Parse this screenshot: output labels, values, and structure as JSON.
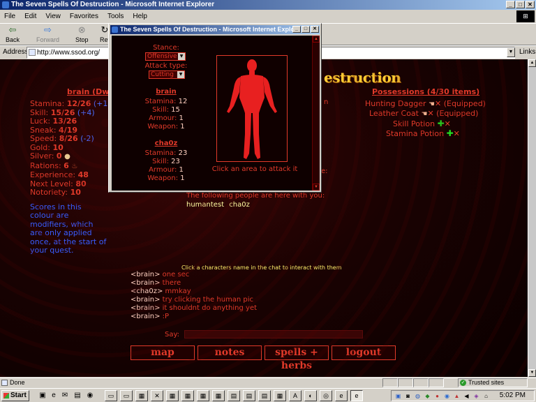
{
  "window": {
    "title": "The Seven Spells Of Destruction - Microsoft Internet Explorer",
    "min": "_",
    "max": "□",
    "close": "✕"
  },
  "menu": [
    "File",
    "Edit",
    "View",
    "Favorites",
    "Tools",
    "Help"
  ],
  "toolbar": {
    "back": "Back",
    "forward": "Forward",
    "stop": "Stop",
    "refresh": "Ref"
  },
  "address": {
    "label": "Address",
    "url": "http://www.ssod.org/",
    "links": "Links"
  },
  "game": {
    "header_fragment": "estruction",
    "char_name": "brain (Dwa",
    "stats": [
      {
        "label": "Stamina:",
        "value": "12/26",
        "mod": "(+1)"
      },
      {
        "label": "Skill:",
        "value": "15/26",
        "mod": "(+4)"
      },
      {
        "label": "Luck:",
        "value": "13/26",
        "mod": ""
      },
      {
        "label": "Sneak:",
        "value": "4/19",
        "mod": ""
      },
      {
        "label": "Speed:",
        "value": "8/26",
        "mod": "(-2)"
      },
      {
        "label": "Gold:",
        "value": "10",
        "mod": ""
      },
      {
        "label": "Silver:",
        "value": "0",
        "mod": ""
      },
      {
        "label": "Rations:",
        "value": "6",
        "mod": ""
      },
      {
        "label": "Experience:",
        "value": "48",
        "mod": ""
      },
      {
        "label": "Next Level:",
        "value": "80",
        "mod": ""
      },
      {
        "label": "Notoriety:",
        "value": "10",
        "mod": ""
      }
    ],
    "modifier_note": "Scores in this colour are modifiers, which are only applied once, at the start of your quest.",
    "possessions_title": "Possessions (4/30 items)",
    "possessions": [
      {
        "name": "Hunting Dagger",
        "status": "(Equipped)"
      },
      {
        "name": "Leather Coat",
        "status": "(Equipped)"
      },
      {
        "name": "Skill Potion",
        "status": ""
      },
      {
        "name": "Stamina Potion",
        "status": ""
      }
    ],
    "fragment_n": "n",
    "fragment_e": "e:",
    "people_line": "The following people are here with you:",
    "people": [
      "humantest",
      "cha0z"
    ],
    "chat_hint": "Click a characters name in the chat to interact with them",
    "chat": [
      {
        "nick": "<brain>",
        "msg": "one sec"
      },
      {
        "nick": "<brain>",
        "msg": "there"
      },
      {
        "nick": "<cha0z>",
        "msg": "mmkay"
      },
      {
        "nick": "<brain>",
        "msg": "try clicking the human pic"
      },
      {
        "nick": "<brain>",
        "msg": "it shouldnt do anything yet"
      },
      {
        "nick": "<brain>",
        "msg": ":P"
      }
    ],
    "say_label": "Say:",
    "nav": [
      "map",
      "notes",
      "spells + herbs",
      "logout"
    ]
  },
  "popup": {
    "title": "The Seven Spells Of Destruction - Microsoft Internet Explo...",
    "stance_label": "Stance:",
    "stance_value": "Offensive",
    "attack_label": "Attack type:",
    "attack_value": "Cutting",
    "player": {
      "name": "brain",
      "stamina": "12",
      "skill": "15",
      "armour": "1",
      "weapon": "1"
    },
    "enemy": {
      "name": "cha0z",
      "stamina": "23",
      "skill": "23",
      "armour": "1",
      "weapon": "1"
    },
    "labels": {
      "stamina": "Stamina:",
      "skill": "Skill:",
      "armour": "Armour:",
      "weapon": "Weapon:"
    },
    "hint": "Click an area to attack it"
  },
  "status": {
    "text": "Done",
    "zone": "Trusted sites"
  },
  "taskbar": {
    "start": "Start",
    "clock": "5:02 PM"
  },
  "colors": {
    "accent_red": "#e23a2a",
    "modifier_blue": "#4a6cff",
    "title_blue": "#0a246a"
  }
}
